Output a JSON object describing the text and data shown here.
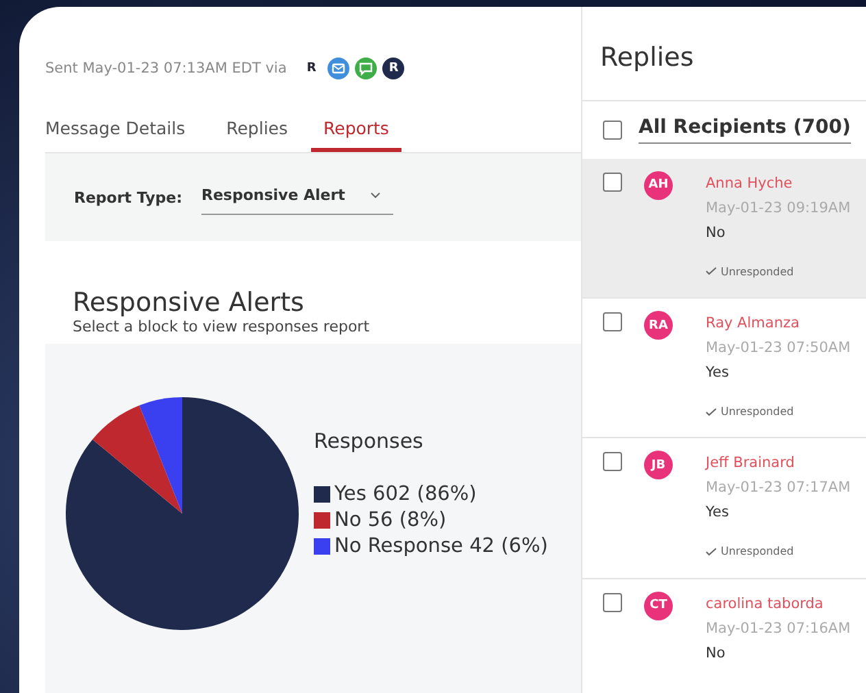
{
  "message": {
    "sent": "Sent May-01-23 07:13AM EDT via",
    "channels": [
      {
        "kind": "app",
        "label": "R"
      },
      {
        "kind": "email"
      },
      {
        "kind": "sms"
      },
      {
        "kind": "app-dark",
        "label": "R"
      }
    ]
  },
  "tabs": [
    {
      "label": "Message Details",
      "selected": false
    },
    {
      "label": "Replies",
      "selected": false
    },
    {
      "label": "Reports",
      "selected": true
    }
  ],
  "report_type": {
    "label": "Report Type:",
    "value": "Responsive Alert"
  },
  "report": {
    "title": "Responsive Alerts",
    "subtitle": "Select a block to view responses report",
    "chart_data": {
      "type": "pie",
      "title": "Responses",
      "categories": [
        "Yes 602 (86%)",
        "No 56 (8%)",
        "No Response 42 (6%)"
      ],
      "colors": [
        "#1f2a4d",
        "#c0282f",
        "#3a3ff0"
      ],
      "series": [
        {
          "values": [
            602,
            56,
            42
          ]
        }
      ]
    }
  },
  "replies": {
    "title": "Replies",
    "header": {
      "label": "All Recipients (700)",
      "checked": false
    },
    "rows": [
      {
        "initials": "AH",
        "name": "Anna Hyche",
        "time": "May-01-23 09:19AM",
        "answer": "No",
        "status": "Unresponded",
        "checked": false,
        "selected": true
      },
      {
        "initials": "RA",
        "name": "Ray Almanza",
        "time": "May-01-23 07:50AM",
        "answer": "Yes",
        "status": "Unresponded",
        "checked": false,
        "selected": false
      },
      {
        "initials": "JB",
        "name": "Jeff Brainard",
        "time": "May-01-23 07:17AM",
        "answer": "Yes",
        "status": "Unresponded",
        "checked": false,
        "selected": false
      },
      {
        "initials": "CT",
        "name": "carolina taborda",
        "time": "May-01-23 07:16AM",
        "answer": "No",
        "status": "",
        "checked": false,
        "selected": false
      }
    ]
  }
}
